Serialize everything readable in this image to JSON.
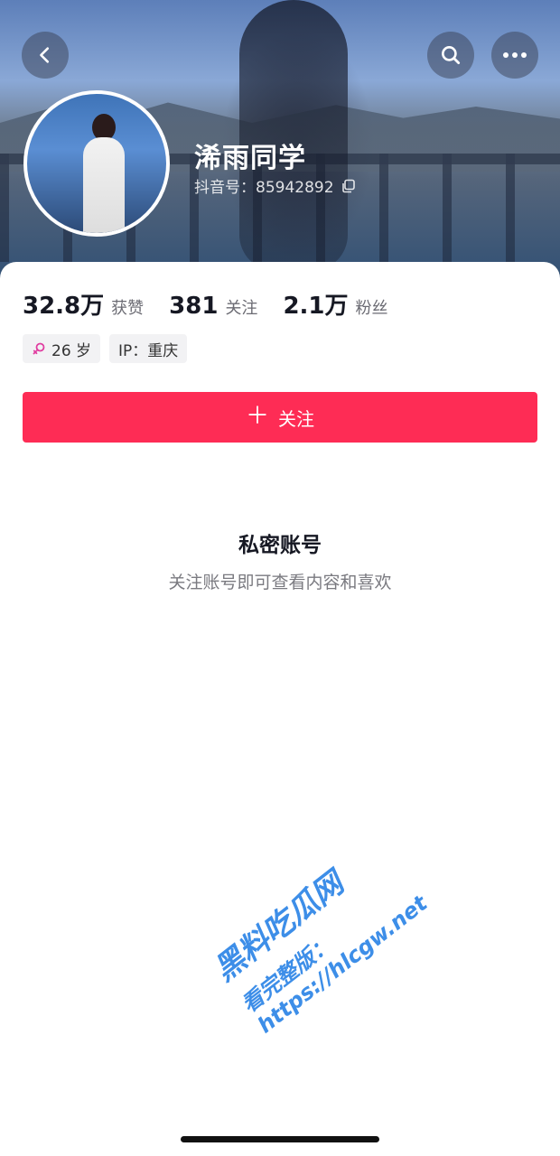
{
  "profile": {
    "name": "浠雨同学",
    "douyin_id": "抖音号：85942892"
  },
  "stats": [
    {
      "value": "32.8万",
      "label": "获赞"
    },
    {
      "value": "381",
      "label": "关注"
    },
    {
      "value": "2.1万",
      "label": "粉丝"
    }
  ],
  "tags": {
    "age": "26 岁",
    "ip": "IP：重庆"
  },
  "follow_button": {
    "label": "关注"
  },
  "private": {
    "title": "私密账号",
    "subtitle": "关注账号即可查看内容和喜欢"
  },
  "watermark": {
    "line1": "黑料吃瓜网",
    "line2": "看完整版：https://hlcgw.net"
  },
  "colors": {
    "accent": "#fe2c55",
    "female_icon": "#e03da0"
  },
  "icons": {
    "back": "chevron-left-icon",
    "search": "search-icon",
    "more": "more-icon",
    "copy": "copy-icon",
    "gender": "female-icon"
  }
}
